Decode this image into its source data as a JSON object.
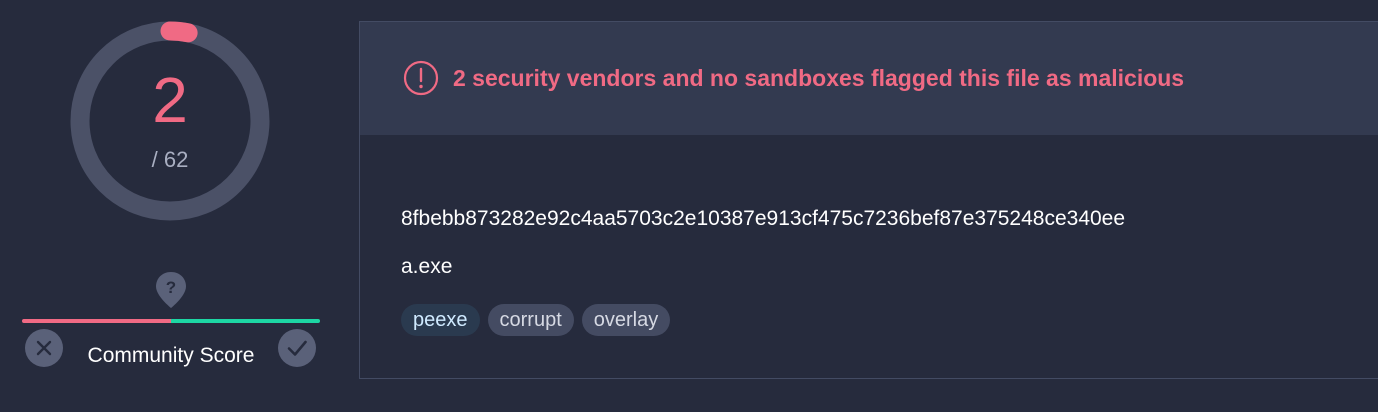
{
  "detection": {
    "count": "2",
    "total_label": "/ 62",
    "detected": 2,
    "total": 62,
    "ring_color": "#4b5167",
    "accent_color": "#f06a84"
  },
  "community": {
    "label": "Community Score",
    "negative_fraction": 0.5,
    "negative_color": "#f06a84",
    "positive_color": "#1dd6a4",
    "help_icon": "question-marker-icon",
    "down_icon": "close-icon",
    "up_icon": "check-icon"
  },
  "alert": {
    "icon": "exclamation-circle-icon",
    "message": "2 security vendors and no sandboxes flagged this file as malicious"
  },
  "file": {
    "hash": "8fbebb873282e92c4aa5703c2e10387e913cf475c7236bef87e375248ce340ee",
    "name": "a.exe",
    "tags": [
      "peexe",
      "corrupt",
      "overlay"
    ]
  }
}
